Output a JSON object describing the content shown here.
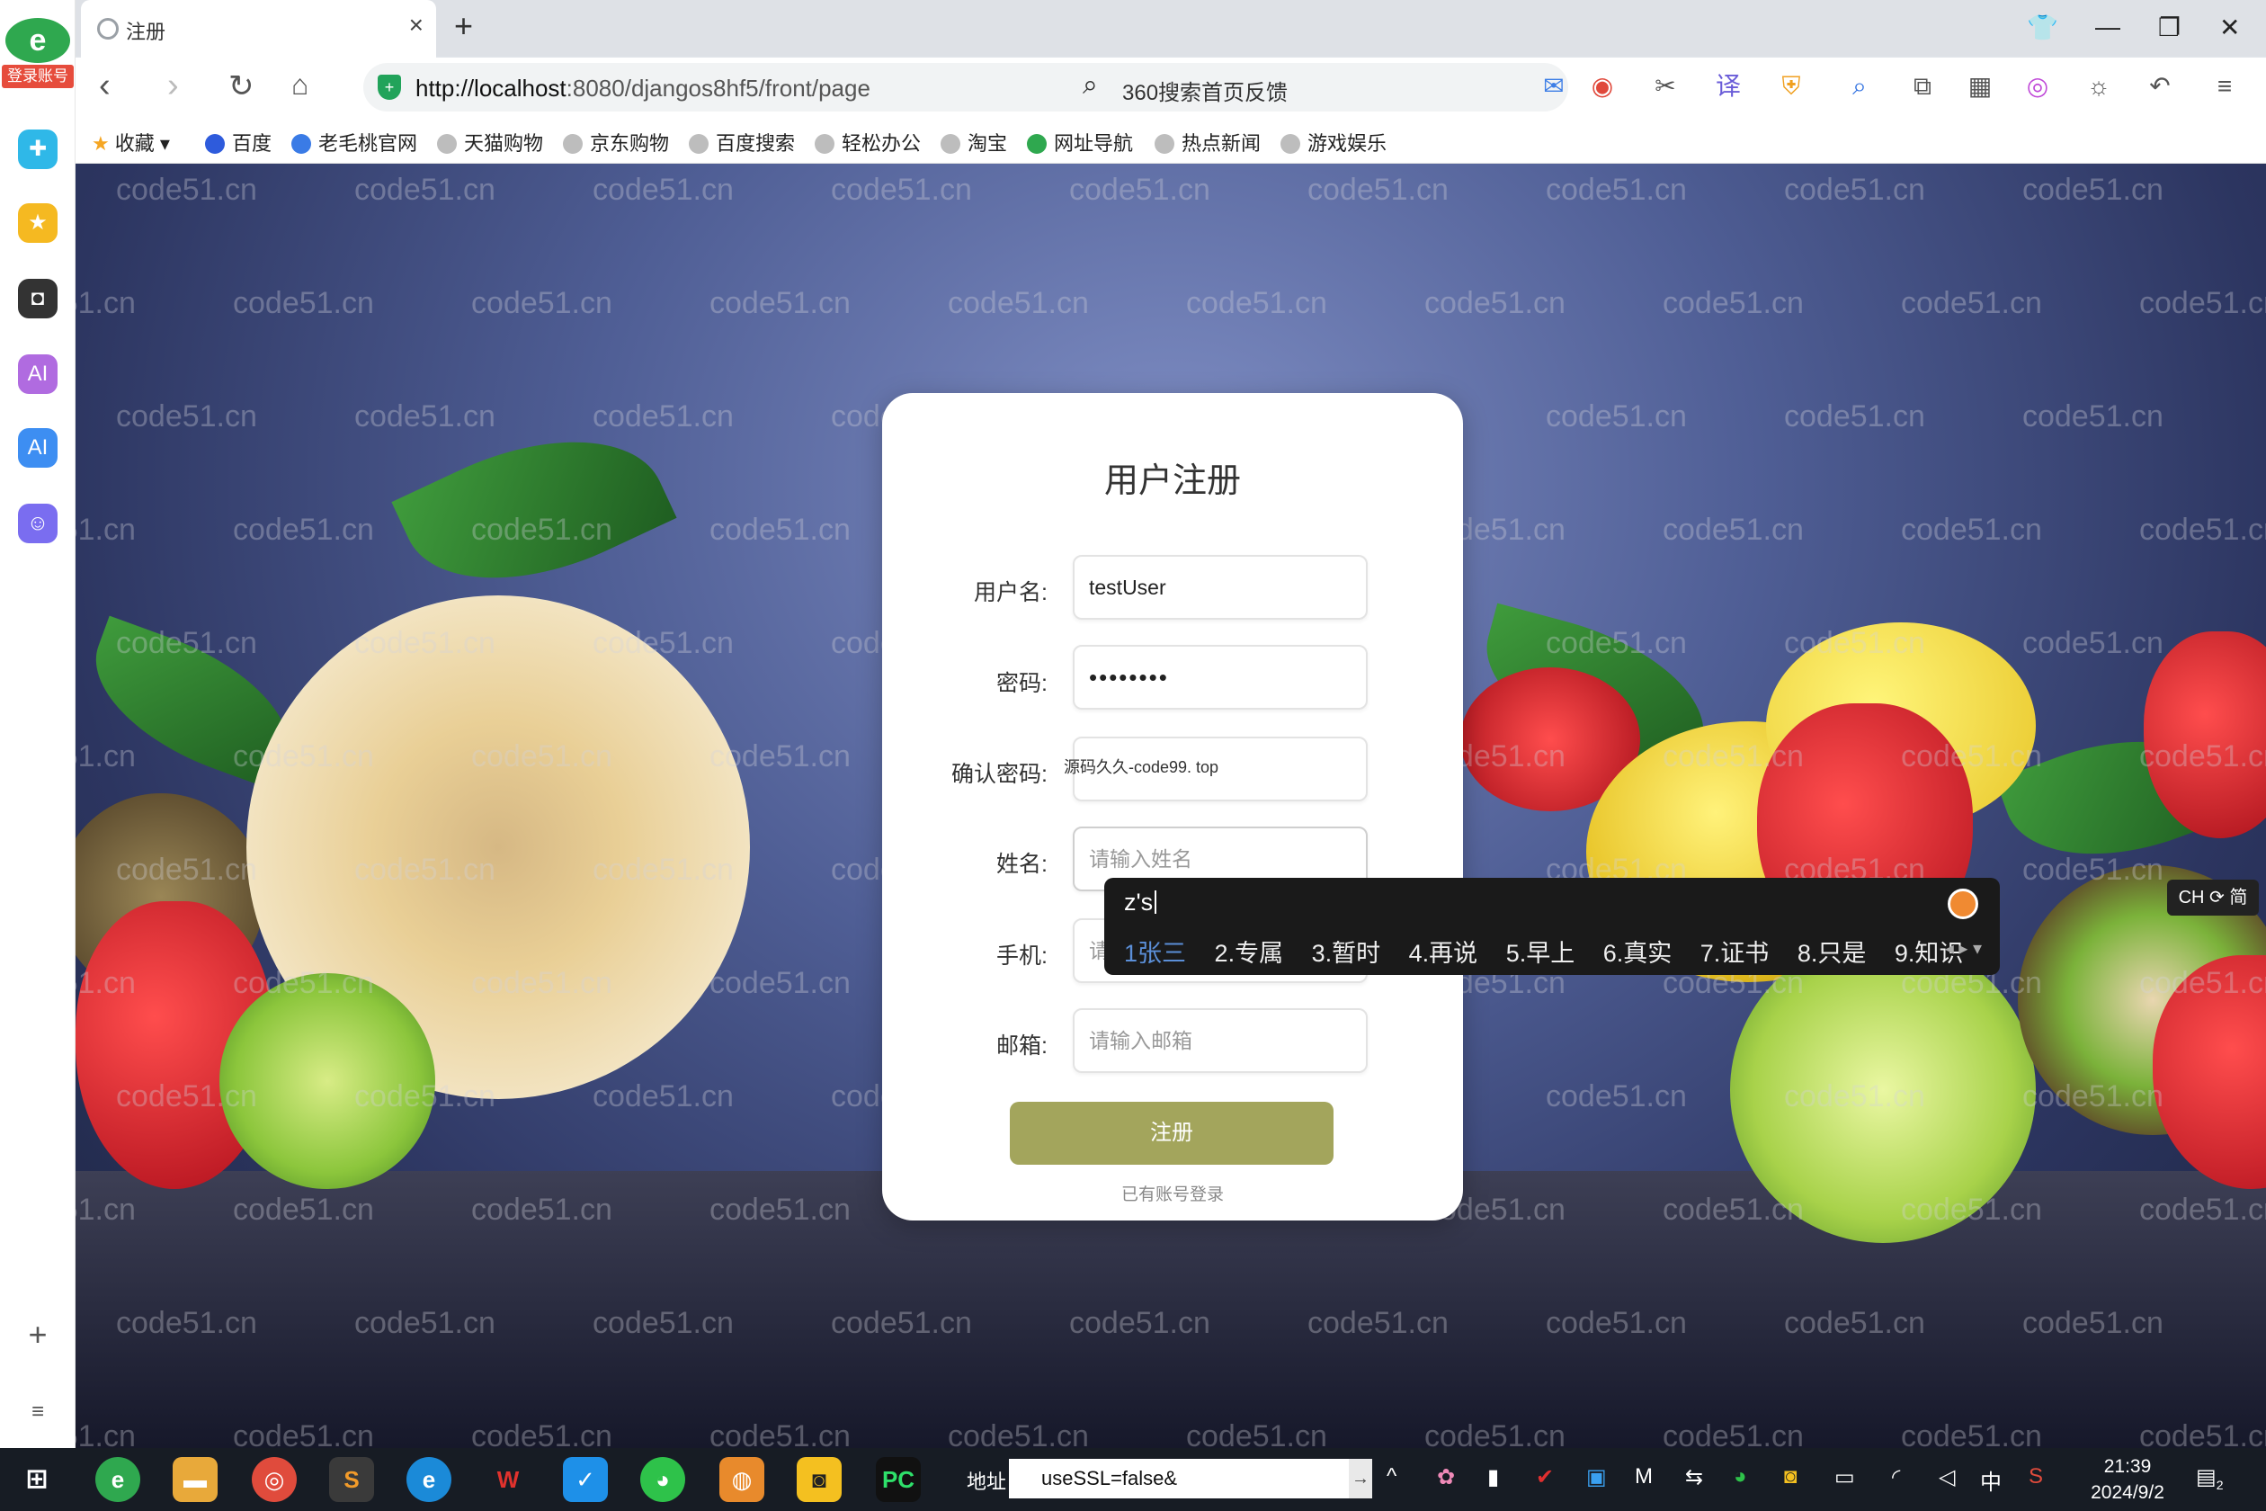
{
  "browser": {
    "tab_title": "注册",
    "new_tab": "+",
    "login_badge": "登录账号",
    "address_url_host": "http://localhost",
    "address_url_rest": ":8080/djangos8hf5/front/page",
    "search_text": "360搜索首页反馈"
  },
  "bookmarks": [
    "收藏",
    "百度",
    "老毛桃官网",
    "天猫购物",
    "京东购物",
    "百度搜索",
    "轻松办公",
    "淘宝",
    "网址导航",
    "热点新闻",
    "游戏娱乐"
  ],
  "watermark": "code51.cn",
  "form": {
    "title": "用户注册",
    "username_label": "用户名:",
    "username_value": "testUser",
    "password_label": "密码:",
    "password_value": "••••••••",
    "confirm_label": "确认密码:",
    "confirm_value": "源码久久-code99. top",
    "name_label": "姓名:",
    "name_placeholder": "请输入姓名",
    "phone_label": "手机:",
    "phone_placeholder": "请",
    "email_label": "邮箱:",
    "email_placeholder": "请输入邮箱",
    "submit_label": "注册",
    "login_link": "已有账号登录"
  },
  "ime": {
    "composition": "z's",
    "candidates": [
      "1张三",
      "2.专属",
      "3.暂时",
      "4.再说",
      "5.早上",
      "6.真实",
      "7.证书",
      "8.只是",
      "9.知识"
    ],
    "status_badge": "CH ⟳ 简"
  },
  "taskbar": {
    "address_label": "地址",
    "address_value": "useSSL=false&",
    "ime_indicator": "中",
    "time": "21:39",
    "date": "2024/9/2",
    "notification_count": "2"
  },
  "colors": {
    "submit_button": "#a3a55c",
    "ime_selected": "#5b8fd8",
    "page_background": "#4f5e95"
  }
}
